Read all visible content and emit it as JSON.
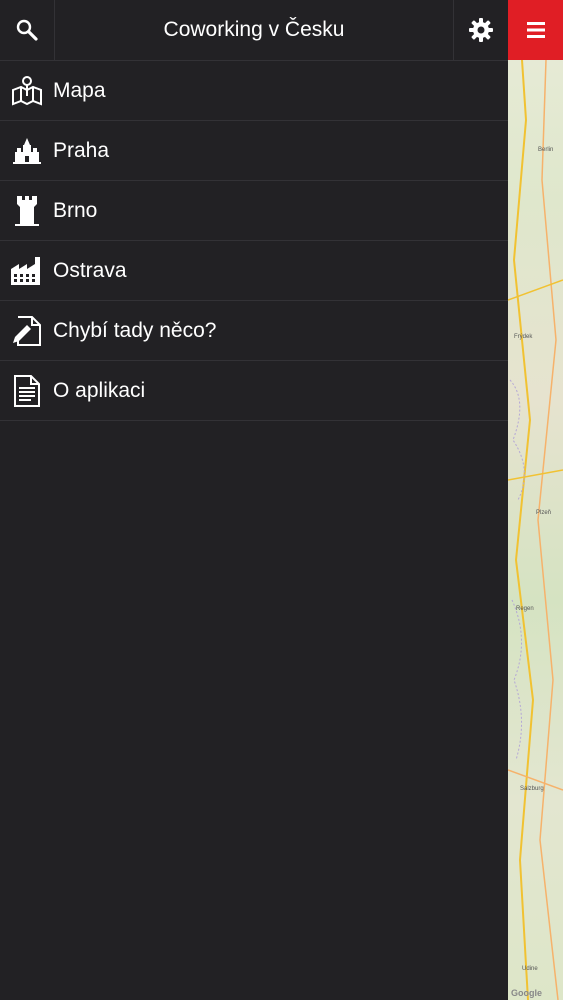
{
  "header": {
    "title": "Coworking v Česku"
  },
  "menu": [
    {
      "label": "Mapa",
      "icon": "map-pin-icon"
    },
    {
      "label": "Praha",
      "icon": "castle-icon"
    },
    {
      "label": "Brno",
      "icon": "tower-icon"
    },
    {
      "label": "Ostrava",
      "icon": "factory-icon"
    },
    {
      "label": "Chybí tady něco?",
      "icon": "edit-document-icon"
    },
    {
      "label": "O aplikaci",
      "icon": "document-icon"
    }
  ],
  "map": {
    "labels": [
      "Berlin",
      "Frýdek",
      "Plzeň",
      "Regen",
      "Salzburg",
      "Udine"
    ],
    "attribution": "Google"
  },
  "colors": {
    "accent": "#e01e25",
    "drawer_bg": "#222124",
    "divider": "#333236"
  }
}
